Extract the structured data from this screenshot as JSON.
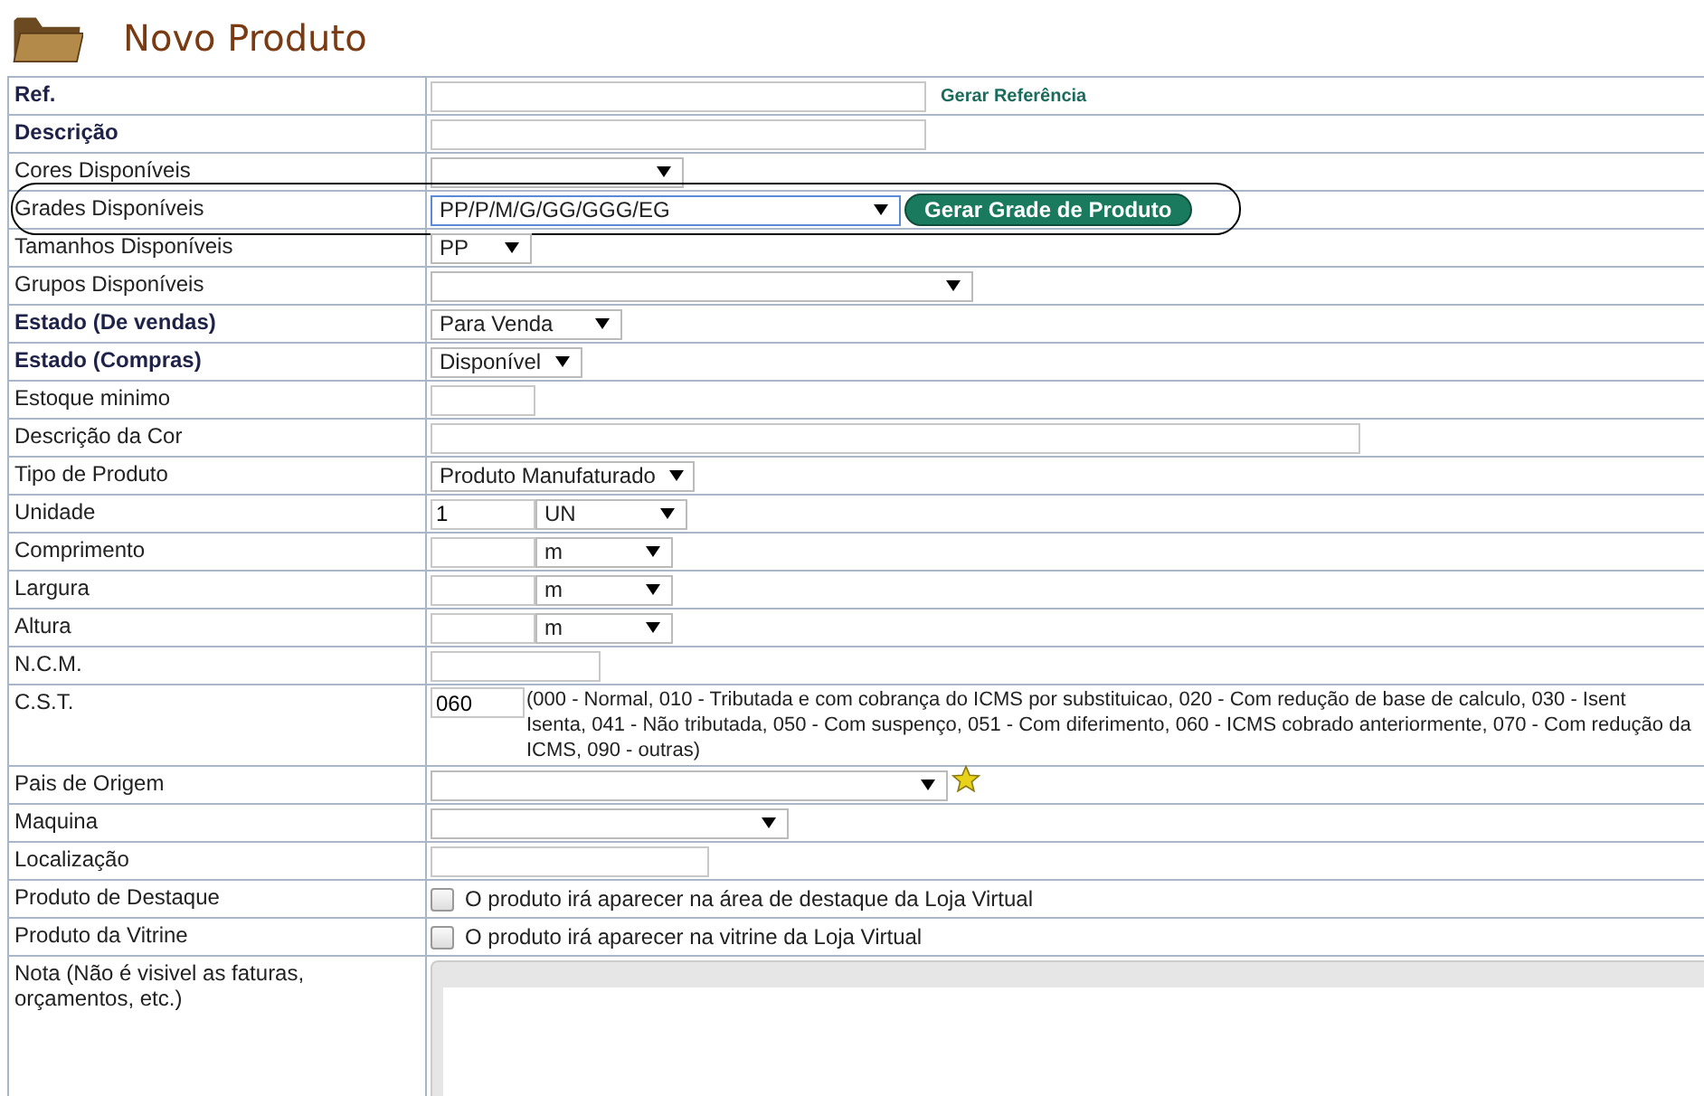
{
  "page": {
    "title": "Novo Produto"
  },
  "rows": [
    {
      "label": "Ref.",
      "bold": true,
      "highlighted": false,
      "fields": [
        {
          "kind": "input"
        },
        {
          "kind": "link",
          "text": "Gerar Referência"
        }
      ]
    },
    {
      "label": "Descrição",
      "bold": true,
      "highlighted": false,
      "fields": [
        {
          "kind": "input"
        }
      ]
    },
    {
      "label": "Cores Disponíveis",
      "bold": false,
      "highlighted": false,
      "fields": [
        {
          "kind": "select"
        }
      ]
    },
    {
      "label": "Grades Disponíveis",
      "bold": false,
      "highlighted": true,
      "fields": [
        {
          "kind": "select",
          "value": "PP/P/M/G/GG/GGG/EG",
          "focused": true
        },
        {
          "kind": "button",
          "text": "Gerar Grade de Produto"
        }
      ]
    },
    {
      "label": "Tamanhos Disponíveis",
      "bold": false,
      "highlighted": false,
      "fields": [
        {
          "kind": "select",
          "value": "PP"
        }
      ]
    },
    {
      "label": "Grupos Disponíveis",
      "bold": false,
      "highlighted": false,
      "fields": [
        {
          "kind": "select"
        }
      ]
    },
    {
      "label": "Estado (De vendas)",
      "bold": true,
      "highlighted": false,
      "fields": [
        {
          "kind": "select",
          "value": "Para Venda"
        }
      ]
    },
    {
      "label": "Estado (Compras)",
      "bold": true,
      "highlighted": false,
      "fields": [
        {
          "kind": "select",
          "value": "Disponível"
        }
      ]
    },
    {
      "label": "Estoque minimo",
      "bold": false,
      "highlighted": false,
      "fields": [
        {
          "kind": "input"
        }
      ]
    },
    {
      "label": "Descrição da Cor",
      "bold": false,
      "highlighted": false,
      "fields": [
        {
          "kind": "input"
        }
      ]
    },
    {
      "label": "Tipo de Produto",
      "bold": false,
      "highlighted": false,
      "fields": [
        {
          "kind": "select",
          "value": "Produto Manufaturado"
        }
      ]
    },
    {
      "label": "Unidade",
      "bold": false,
      "highlighted": false,
      "fields": [
        {
          "kind": "input",
          "value": "1"
        },
        {
          "kind": "select",
          "value": "UN"
        }
      ]
    },
    {
      "label": "Comprimento",
      "bold": false,
      "highlighted": false,
      "fields": [
        {
          "kind": "input"
        },
        {
          "kind": "select",
          "value": "m"
        }
      ]
    },
    {
      "label": "Largura",
      "bold": false,
      "highlighted": false,
      "fields": [
        {
          "kind": "input"
        },
        {
          "kind": "select",
          "value": "m"
        }
      ]
    },
    {
      "label": "Altura",
      "bold": false,
      "highlighted": false,
      "fields": [
        {
          "kind": "input"
        },
        {
          "kind": "select",
          "value": "m"
        }
      ]
    },
    {
      "label": "N.C.M.",
      "bold": false,
      "highlighted": false,
      "fields": [
        {
          "kind": "input"
        }
      ]
    },
    {
      "label": "C.S.T.",
      "bold": false,
      "highlighted": false,
      "fields": [
        {
          "kind": "input",
          "value": "060"
        },
        {
          "kind": "note",
          "lines": [
            "(000 - Normal, 010 - Tributada e com cobrança do ICMS por substituicao, 020 - Com redução de base de calculo, 030 - Isent",
            "Isenta, 041 - Não tributada, 050 - Com suspenço, 051 - Com diferimento, 060 - ICMS cobrado anteriormente, 070 - Com redução da",
            "ICMS, 090 - outras)"
          ]
        }
      ]
    },
    {
      "label": "Pais de Origem",
      "bold": false,
      "highlighted": false,
      "fields": [
        {
          "kind": "select"
        },
        {
          "kind": "star"
        }
      ]
    },
    {
      "label": "Maquina",
      "bold": false,
      "highlighted": false,
      "fields": [
        {
          "kind": "select"
        }
      ]
    },
    {
      "label": "Localização",
      "bold": false,
      "highlighted": false,
      "fields": [
        {
          "kind": "input"
        }
      ]
    },
    {
      "label": "Produto de Destaque",
      "bold": false,
      "highlighted": false,
      "fields": [
        {
          "kind": "checkbox",
          "checked": false,
          "text": "O produto irá aparecer na área de destaque da Loja Virtual"
        }
      ]
    },
    {
      "label": "Produto da Vitrine",
      "bold": false,
      "highlighted": false,
      "fields": [
        {
          "kind": "checkbox",
          "checked": false,
          "text": "O produto irá aparecer na vitrine da Loja Virtual"
        }
      ]
    },
    {
      "label": "Nota (Não é visivel as faturas, orçamentos, etc.)",
      "bold": false,
      "highlighted": false,
      "fields": [
        {
          "kind": "editor"
        }
      ]
    }
  ]
}
